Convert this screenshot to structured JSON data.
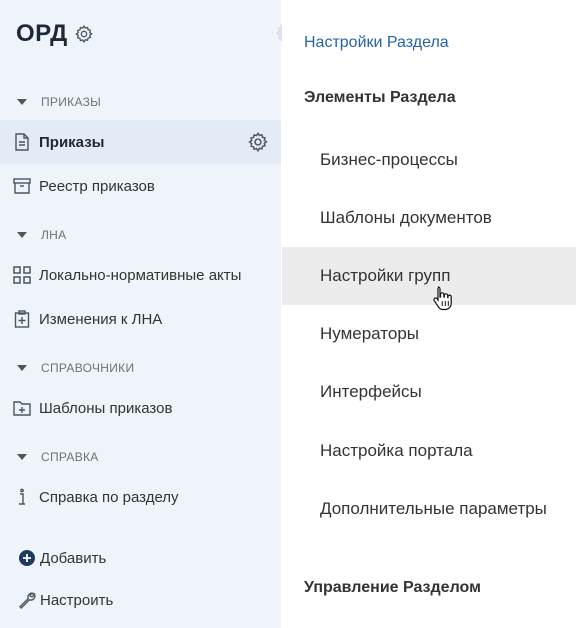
{
  "sidebar": {
    "app_title": "ОРД",
    "groups": {
      "orders": "ПРИКАЗЫ",
      "lna": "ЛНА",
      "refs": "СПРАВОЧНИКИ",
      "help": "СПРАВКА"
    },
    "items": {
      "orders": "Приказы",
      "orders_registry": "Реестр приказов",
      "local_acts": "Локально-нормативные акты",
      "lna_changes": "Изменения к ЛНА",
      "order_templates": "Шаблоны приказов",
      "section_help": "Справка по разделу"
    },
    "actions": {
      "add": "Добавить",
      "configure": "Настроить"
    }
  },
  "panel": {
    "title": "Настройки Раздела",
    "section_elements": "Элементы Раздела",
    "menu": [
      "Бизнес-процессы",
      "Шаблоны документов",
      "Настройки групп",
      "Нумераторы",
      "Интерфейсы",
      "Настройка портала",
      "Дополнительные параметры"
    ],
    "section_manage": "Управление Разделом"
  },
  "colors": {
    "sidebar_bg": "#eff4fa",
    "active_item_bg": "#e3ecf6",
    "accent_blue": "#2563a8",
    "hover_bg": "#ececec"
  }
}
